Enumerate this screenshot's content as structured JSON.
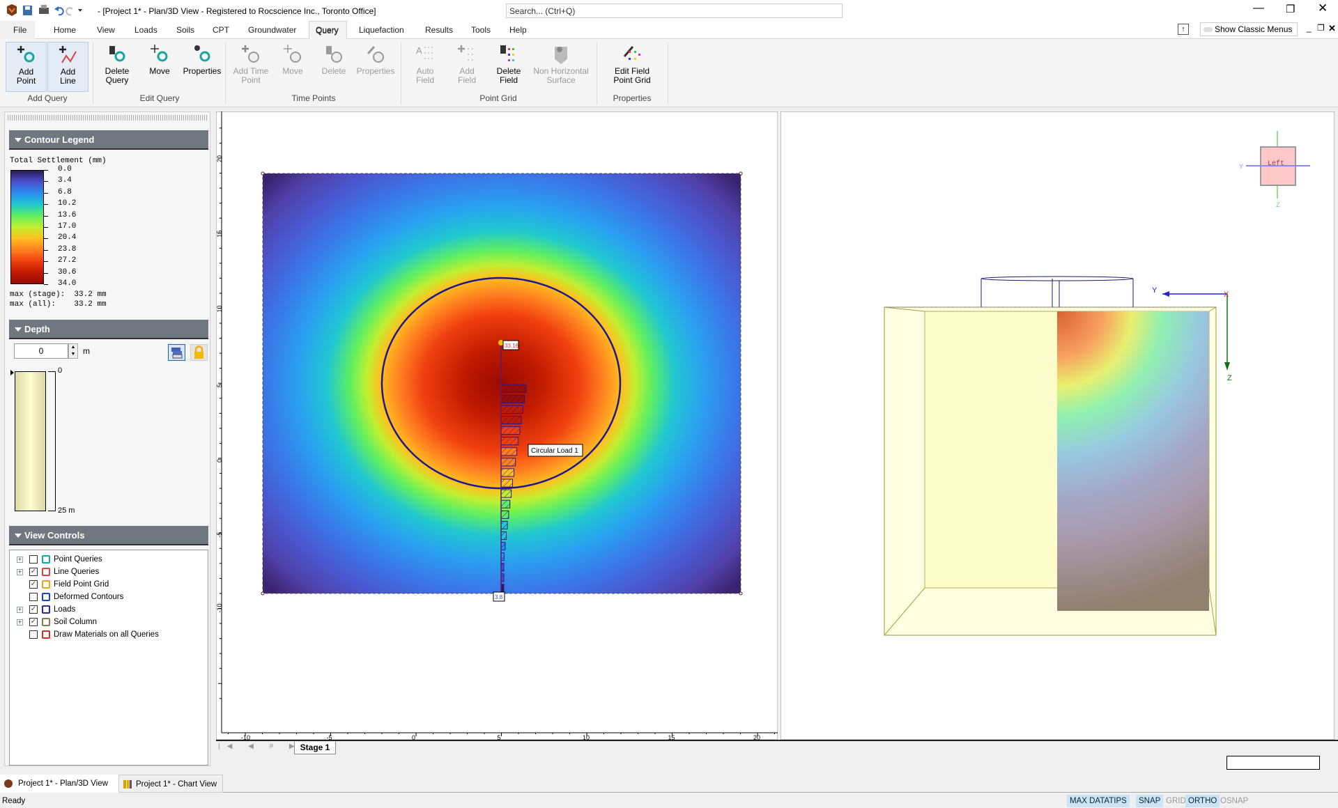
{
  "window": {
    "title": "- [Project 1* - Plan/3D View - Registered to Rocscience Inc., Toronto Office]",
    "search_placeholder": "Search... (Ctrl+Q)",
    "show_classic_menus": "Show Classic Menus"
  },
  "menu": {
    "tabs": [
      "File",
      "Home",
      "View",
      "Loads",
      "Soils",
      "CPT",
      "Groundwater",
      "Query",
      "Liquefaction",
      "Results",
      "Tools",
      "Help"
    ],
    "selected": "Query"
  },
  "ribbon": {
    "groups": [
      {
        "label": "Add Query",
        "buttons": [
          {
            "l1": "Add",
            "l2": "Point"
          },
          {
            "l1": "Add",
            "l2": "Line"
          }
        ]
      },
      {
        "label": "Edit Query",
        "buttons": [
          {
            "l1": "Delete",
            "l2": "Query"
          },
          {
            "l1": "Move",
            "l2": ""
          },
          {
            "l1": "Properties",
            "l2": ""
          }
        ]
      },
      {
        "label": "Time Points",
        "buttons": [
          {
            "l1": "Add Time",
            "l2": "Point"
          },
          {
            "l1": "Move",
            "l2": ""
          },
          {
            "l1": "Delete",
            "l2": ""
          },
          {
            "l1": "Properties",
            "l2": ""
          }
        ]
      },
      {
        "label": "Point Grid",
        "buttons": [
          {
            "l1": "Auto",
            "l2": "Field"
          },
          {
            "l1": "Add",
            "l2": "Field"
          },
          {
            "l1": "Delete",
            "l2": "Field"
          },
          {
            "l1": "Non Horizontal",
            "l2": "Surface"
          }
        ]
      },
      {
        "label": "Properties",
        "buttons": [
          {
            "l1": "Edit Field",
            "l2": "Point Grid"
          }
        ]
      }
    ]
  },
  "legend": {
    "header": "Contour Legend",
    "title": "Total Settlement (mm)",
    "ticks": [
      "0.0",
      "3.4",
      "6.8",
      "10.2",
      "13.6",
      "17.0",
      "20.4",
      "23.8",
      "27.2",
      "30.6",
      "34.0"
    ],
    "colors": [
      "#2c1a55",
      "#4a4fd0",
      "#2a8ef0",
      "#20c8d0",
      "#60f060",
      "#c0f030",
      "#ffc020",
      "#ff8020",
      "#f04010",
      "#c01a00",
      "#9a0a00"
    ],
    "max_stage": "max (stage):  33.2 mm",
    "max_all": "max (all):    33.2 mm"
  },
  "depth": {
    "header": "Depth",
    "value": "0",
    "unit": "m",
    "top_label": "0",
    "bottom_label": "25 m"
  },
  "view_controls": {
    "header": "View Controls",
    "items": [
      {
        "label": "Point Queries",
        "checked": false,
        "expandable": true,
        "icon": "point-query-icon"
      },
      {
        "label": "Line Queries",
        "checked": true,
        "expandable": true,
        "icon": "line-query-icon"
      },
      {
        "label": "Field Point Grid",
        "checked": true,
        "expandable": false,
        "icon": "field-grid-icon"
      },
      {
        "label": "Deformed Contours",
        "checked": false,
        "expandable": false,
        "icon": "deformed-contours-icon"
      },
      {
        "label": "Loads",
        "checked": true,
        "expandable": true,
        "icon": "loads-icon"
      },
      {
        "label": "Soil Column",
        "checked": true,
        "expandable": true,
        "icon": "soil-column-icon"
      },
      {
        "label": "Draw Materials on all Queries",
        "checked": false,
        "expandable": false,
        "icon": "materials-icon"
      }
    ]
  },
  "plan": {
    "x_ticks": [
      "-10",
      "-5",
      "0",
      "5",
      "10",
      "15",
      "20"
    ],
    "y_ticks": [
      "20",
      "15",
      "10",
      "5",
      "0",
      "-5",
      "-10"
    ],
    "load_label": "Circular Load 1",
    "query_top_value": "33.16",
    "query_bottom_value": "3.8"
  },
  "view3d": {
    "nav_cube": "Left",
    "axes": {
      "x": "X",
      "y": "Y",
      "z": "Z"
    }
  },
  "stage_tabs": [
    "Stage 1"
  ],
  "doc_tabs": [
    "Project 1* - Plan/3D View",
    "Project 1* - Chart View"
  ],
  "status": {
    "text": "Ready",
    "indicators": [
      {
        "label": "MAX DATATIPS",
        "on": true
      },
      {
        "label": "SNAP",
        "on": true
      },
      {
        "label": "GRID",
        "on": false
      },
      {
        "label": "ORTHO",
        "on": true
      },
      {
        "label": "OSNAP",
        "on": false
      }
    ]
  }
}
